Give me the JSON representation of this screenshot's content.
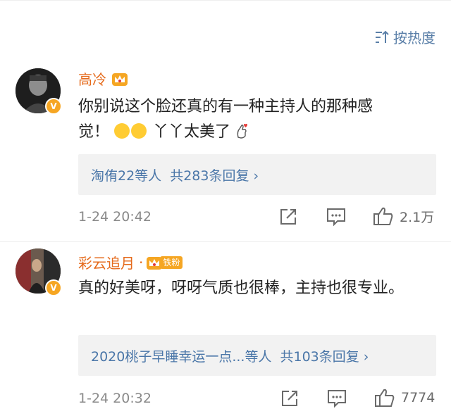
{
  "sort": {
    "label": "按热度"
  },
  "comments": [
    {
      "name": "高冷",
      "text_line1": "你别说这个脸还真的有一种主持人的那种感",
      "text_line2_start": "觉！",
      "text_line2_end": "丫丫太美了",
      "replies_users": "淘侑22等人",
      "replies_count": "共283条回复 ›",
      "time": "1-24 20:42",
      "likes": "2.1万",
      "avatar_badge": "V"
    },
    {
      "name": "彩云追月",
      "name_dot": "·",
      "fan_badge": "铁粉",
      "text": "真的好美呀，呀呀气质也很棒，主持也很专业。",
      "replies_users": "2020桃子早睡幸运一点...等人",
      "replies_count": "共103条回复 ›",
      "time": "1-24 20:32",
      "likes": "7774",
      "avatar_badge": "V"
    }
  ],
  "colors": {
    "name": "#e56a1b",
    "link": "#4a76a8",
    "badge": "#f6a623"
  }
}
